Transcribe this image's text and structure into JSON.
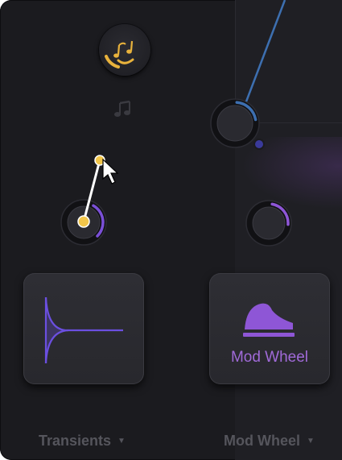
{
  "colors": {
    "panel": "#1b1b1f",
    "accent_purple": "#8e56d6",
    "envelope_purple": "#6b4fe0",
    "link_blue": "#3d6fb0",
    "badge_yellow": "#e8b23c",
    "tile_text": "#a06ad8",
    "dropdown_text": "#55555c"
  },
  "badge": {
    "icon": "transient-shaper-badge-icon"
  },
  "note_icon": "music-note-icon",
  "knobs": {
    "top_right": {
      "icon": "knob-icon",
      "mod_amount": 0.25,
      "mod_color": "#3d6fb0"
    },
    "mid_left": {
      "icon": "knob-icon",
      "mod_amount": 0.35,
      "mod_color": "#7a4fd6"
    },
    "mid_right": {
      "icon": "knob-icon",
      "mod_amount": 0.28,
      "mod_color": "#8e56d6"
    }
  },
  "tiles": {
    "left": {
      "icon": "transient-envelope-icon",
      "caption": ""
    },
    "right": {
      "icon": "mod-wheel-icon",
      "caption": "Mod Wheel"
    }
  },
  "dropdowns": {
    "left": {
      "label": "Transients",
      "icon": "chevron-down-icon"
    },
    "right": {
      "label": "Mod Wheel",
      "icon": "chevron-down-icon"
    }
  },
  "cursor": {
    "icon": "pointer-cursor-icon"
  }
}
